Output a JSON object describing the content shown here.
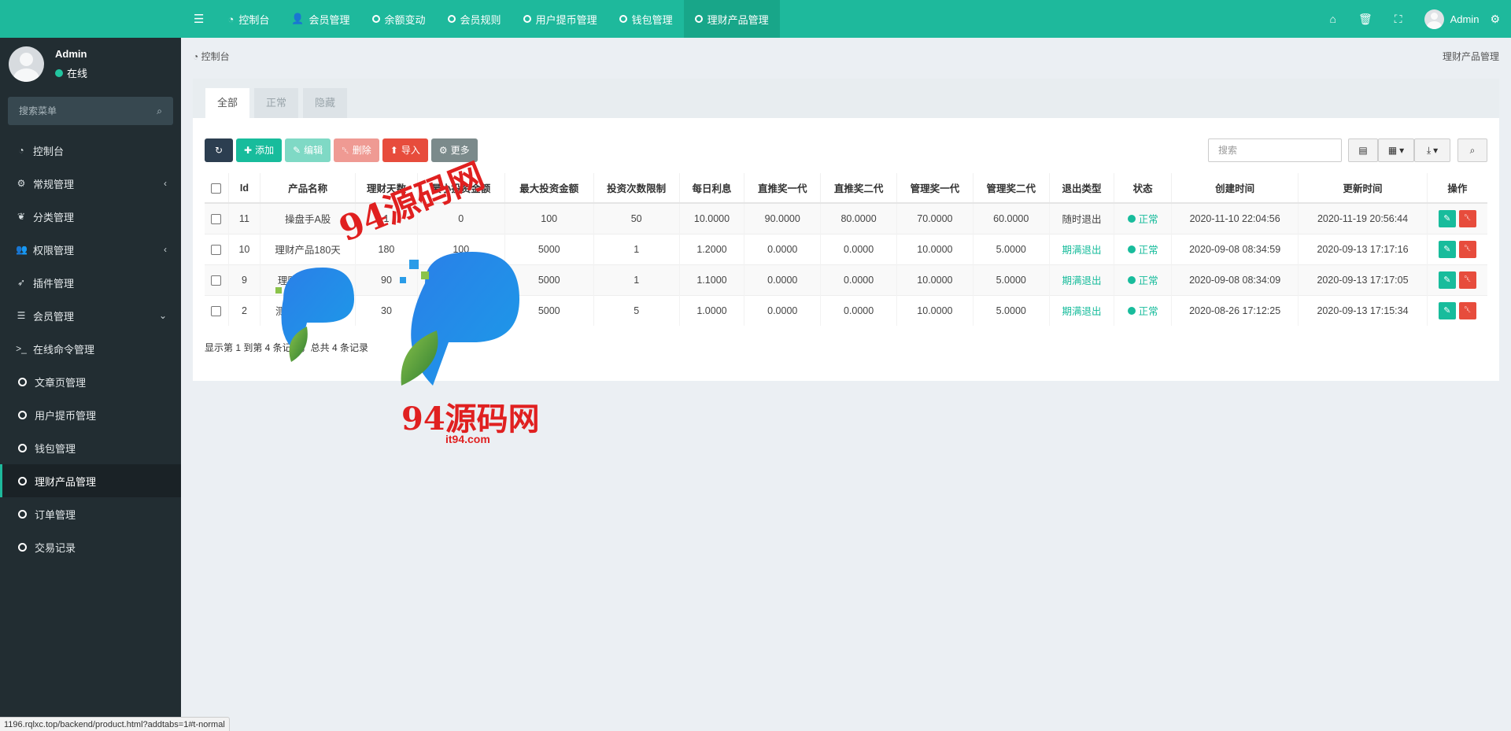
{
  "user": {
    "name": "Admin",
    "status": "在线"
  },
  "sidebar": {
    "search_placeholder": "搜索菜单",
    "items": [
      {
        "label": "控制台",
        "icon": "dashboard-icon",
        "glyph": "◔",
        "arrow": ""
      },
      {
        "label": "常规管理",
        "icon": "cogs-icon",
        "glyph": "⚙",
        "arrow": "‹"
      },
      {
        "label": "分类管理",
        "icon": "leaf-icon",
        "glyph": "❦",
        "arrow": ""
      },
      {
        "label": "权限管理",
        "icon": "users-icon",
        "glyph": "👥",
        "arrow": "‹"
      },
      {
        "label": "插件管理",
        "icon": "rocket-icon",
        "glyph": "➶",
        "arrow": ""
      },
      {
        "label": "会员管理",
        "icon": "list-icon",
        "glyph": "☰",
        "arrow": "⌄"
      },
      {
        "label": "在线命令管理",
        "icon": "terminal-icon",
        "glyph": ">_",
        "arrow": ""
      },
      {
        "label": "文章页管理",
        "icon": "circle-icon",
        "glyph": "",
        "arrow": ""
      },
      {
        "label": "用户提币管理",
        "icon": "circle-icon",
        "glyph": "",
        "arrow": ""
      },
      {
        "label": "钱包管理",
        "icon": "circle-icon",
        "glyph": "",
        "arrow": ""
      },
      {
        "label": "理财产品管理",
        "icon": "circle-icon",
        "glyph": "",
        "arrow": ""
      },
      {
        "label": "订单管理",
        "icon": "circle-icon",
        "glyph": "",
        "arrow": ""
      },
      {
        "label": "交易记录",
        "icon": "circle-icon",
        "glyph": "",
        "arrow": ""
      }
    ]
  },
  "topnav": {
    "tabs": [
      {
        "label": "控制台",
        "icon": "dashboard-icon"
      },
      {
        "label": "会员管理",
        "icon": "user-icon"
      },
      {
        "label": "余额变动",
        "icon": "circle-icon"
      },
      {
        "label": "会员规则",
        "icon": "circle-icon"
      },
      {
        "label": "用户提币管理",
        "icon": "circle-icon"
      },
      {
        "label": "钱包管理",
        "icon": "circle-icon"
      },
      {
        "label": "理财产品管理",
        "icon": "circle-icon"
      }
    ],
    "admin_label": "Admin"
  },
  "breadcrumb": {
    "home": "控制台",
    "current": "理财产品管理"
  },
  "panel_tabs": [
    "全部",
    "正常",
    "隐藏"
  ],
  "toolbar": {
    "add": "添加",
    "edit": "编辑",
    "delete": "删除",
    "import": "导入",
    "more": "更多",
    "search_placeholder": "搜索"
  },
  "table": {
    "columns": [
      "Id",
      "产品名称",
      "理财天数",
      "最小投资金额",
      "最大投资金额",
      "投资次数限制",
      "每日利息",
      "直推奖一代",
      "直推奖二代",
      "管理奖一代",
      "管理奖二代",
      "退出类型",
      "状态",
      "创建时间",
      "更新时间",
      "操作"
    ],
    "rows": [
      [
        "11",
        "操盘手A股",
        "1",
        "0",
        "100",
        "50",
        "10.0000",
        "90.0000",
        "80.0000",
        "70.0000",
        "60.0000",
        "随时退出",
        "正常",
        "2020-11-10 22:04:56",
        "2020-11-19 20:56:44"
      ],
      [
        "10",
        "理财产品180天",
        "180",
        "100",
        "5000",
        "1",
        "1.2000",
        "0.0000",
        "0.0000",
        "10.0000",
        "5.0000",
        "期满退出",
        "正常",
        "2020-09-08 08:34:59",
        "2020-09-13 17:17:16"
      ],
      [
        "9",
        "理财产品90天",
        "90",
        "100",
        "5000",
        "1",
        "1.1000",
        "0.0000",
        "0.0000",
        "10.0000",
        "5.0000",
        "期满退出",
        "正常",
        "2020-09-08 08:34:09",
        "2020-09-13 17:17:05"
      ],
      [
        "2",
        "测试理财产品2",
        "30",
        "100",
        "5000",
        "5",
        "1.0000",
        "0.0000",
        "0.0000",
        "10.0000",
        "5.0000",
        "期满退出",
        "正常",
        "2020-08-26 17:12:25",
        "2020-09-13 17:15:34"
      ]
    ]
  },
  "pager_text": "显示第 1 到第 4 条记录，总共 4 条记录",
  "status_url": "1196.rqlxc.top/backend/product.html?addtabs=1#t-normal",
  "watermark": {
    "top": "94源码网",
    "bottom": "94源码网",
    "url": "it94.com"
  },
  "colors": {
    "accent": "#1eb99c",
    "sidebar_bg": "#222d32",
    "danger": "#e74c3c"
  }
}
